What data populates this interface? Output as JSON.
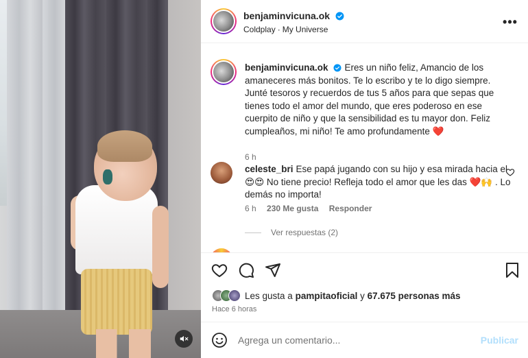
{
  "post": {
    "username": "benjaminvicuna.ok",
    "song": {
      "artist": "Coldplay",
      "title": "My Universe",
      "separator": "·"
    },
    "more_label": "•••"
  },
  "caption": {
    "username": "benjaminvicuna.ok",
    "text": "Eres un niño feliz, Amancio de los amaneceres más bonitos. Te lo escribo y te lo digo siempre. Junté tesoros y recuerdos de tus 5 años para que sepas que tienes todo el amor del mundo, que eres poderoso en ese cuerpito de niño y que la sensibilidad es tu mayor don. Feliz cumpleaños, mi niño! Te amo profundamente",
    "emoji": "❤️",
    "time": "6 h"
  },
  "comment": {
    "username": "celeste_bri",
    "text_1": "Ese papá jugando con su hijo y esa mirada hacia el",
    "emoji_1": "😍😍",
    "text_2": "No tiene precio! Refleja todo el amor que les das",
    "emoji_2": "❤️🙌",
    "text_3": ". Lo demás no importa!",
    "time": "6 h",
    "likes": "230 Me gusta",
    "reply_label": "Responder",
    "view_replies": "Ver respuestas (2)"
  },
  "likes": {
    "prefix": "Les gusta a",
    "first_user": "pampitaoficial",
    "middle": "y",
    "others": "67.675 personas más"
  },
  "posted_ago": "Hace 6 horas",
  "composer": {
    "placeholder": "Agrega un comentario...",
    "post_label": "Publicar"
  },
  "colors": {
    "link_disabled": "#b2dffc",
    "heart_red": "#e0245e",
    "verified_blue": "#0095f6",
    "secondary_text": "#737373"
  }
}
